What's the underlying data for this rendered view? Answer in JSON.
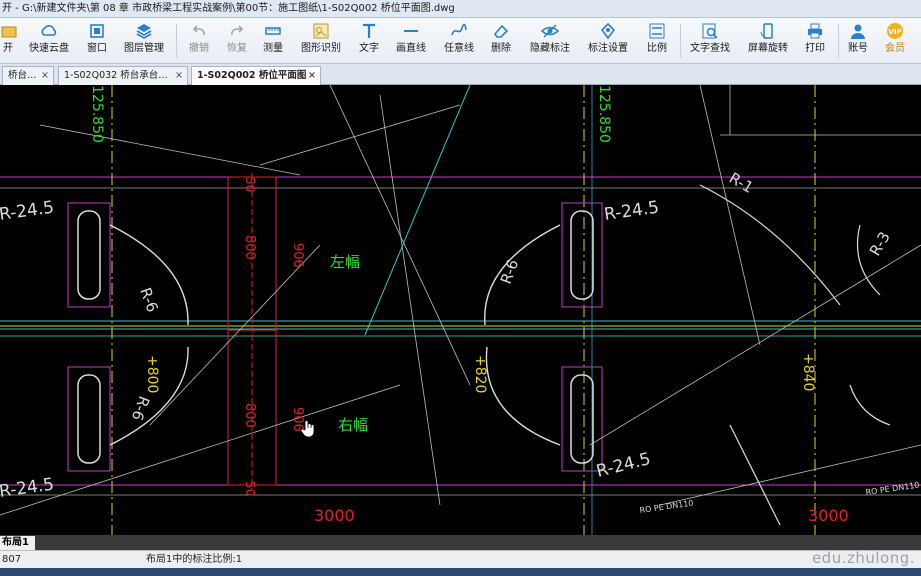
{
  "window": {
    "title": "开 - G:\\新建文件夹\\第 08 章 市政桥梁工程实战案例\\第00节：施工图纸\\1-S02Q002 桥位平面图.dwg"
  },
  "toolbar": {
    "items": [
      {
        "label": "开",
        "icon": "open-icon"
      },
      {
        "label": "快速云盘",
        "icon": "cloud-icon"
      },
      {
        "label": "窗口",
        "icon": "window-icon"
      },
      {
        "label": "图层管理",
        "icon": "layers-icon"
      },
      {
        "label": "撤销",
        "icon": "undo-icon"
      },
      {
        "label": "恢复",
        "icon": "redo-icon"
      },
      {
        "label": "测量",
        "icon": "measure-icon"
      },
      {
        "label": "图形识别",
        "icon": "shape-recognition-icon"
      },
      {
        "label": "文字",
        "icon": "text-icon"
      },
      {
        "label": "画直线",
        "icon": "line-icon"
      },
      {
        "label": "任意线",
        "icon": "freehand-icon"
      },
      {
        "label": "删除",
        "icon": "eraser-icon"
      },
      {
        "label": "隐藏标注",
        "icon": "eye-icon"
      },
      {
        "label": "标注设置",
        "icon": "annotation-settings-icon"
      },
      {
        "label": "比例",
        "icon": "scale-icon"
      },
      {
        "label": "文字查找",
        "icon": "text-search-icon"
      },
      {
        "label": "屏幕旋转",
        "icon": "rotate-screen-icon"
      },
      {
        "label": "打印",
        "icon": "print-icon"
      },
      {
        "label": "账号",
        "icon": "account-icon"
      },
      {
        "label": "会员",
        "icon": "vip-icon"
      }
    ]
  },
  "tabs": [
    {
      "label": "桥台…",
      "close": "×"
    },
    {
      "label": "1-S02Q032 桥台承台…",
      "close": "×"
    },
    {
      "label": "1-S02Q002 桥位平面图",
      "close": "×"
    }
  ],
  "drawing": {
    "texts": {
      "r245_a": "R-24.5",
      "r245_b": "R-24.5",
      "r245_c": "R-24.5",
      "r245_d": "R-24.5",
      "r6_a": "R-6",
      "r6_b": "R-6",
      "r6_c": "R-6",
      "r3": "R-3",
      "r1": "R-1",
      "left_width": "左幅",
      "right_width": "右幅",
      "dim800_a": "800",
      "dim800_b": "800",
      "dim906_a": "906",
      "dim906_b": "906",
      "dim50_a": "50",
      "dim50_b": "50",
      "dim3000_a": "3000",
      "dim3000_b": "3000",
      "elev_a": "+800",
      "elev_b": "+820",
      "elev_c": "+840",
      "st_a": "125.850",
      "st_b": "125.850",
      "rope_a": "RO PE DN110",
      "rope_b": "RO PE DN110"
    }
  },
  "layout": {
    "tab": "布局1"
  },
  "status": {
    "left": "807",
    "message": "布局1中的标注比例:1"
  },
  "watermark": "edu.zhulong.",
  "colors": {
    "canvas": "#000000",
    "red": "#e0202a",
    "green": "#2fdc2f",
    "yellow": "#e6d21a",
    "cyan": "#34c6c6",
    "magenta": "#c33cc3"
  }
}
